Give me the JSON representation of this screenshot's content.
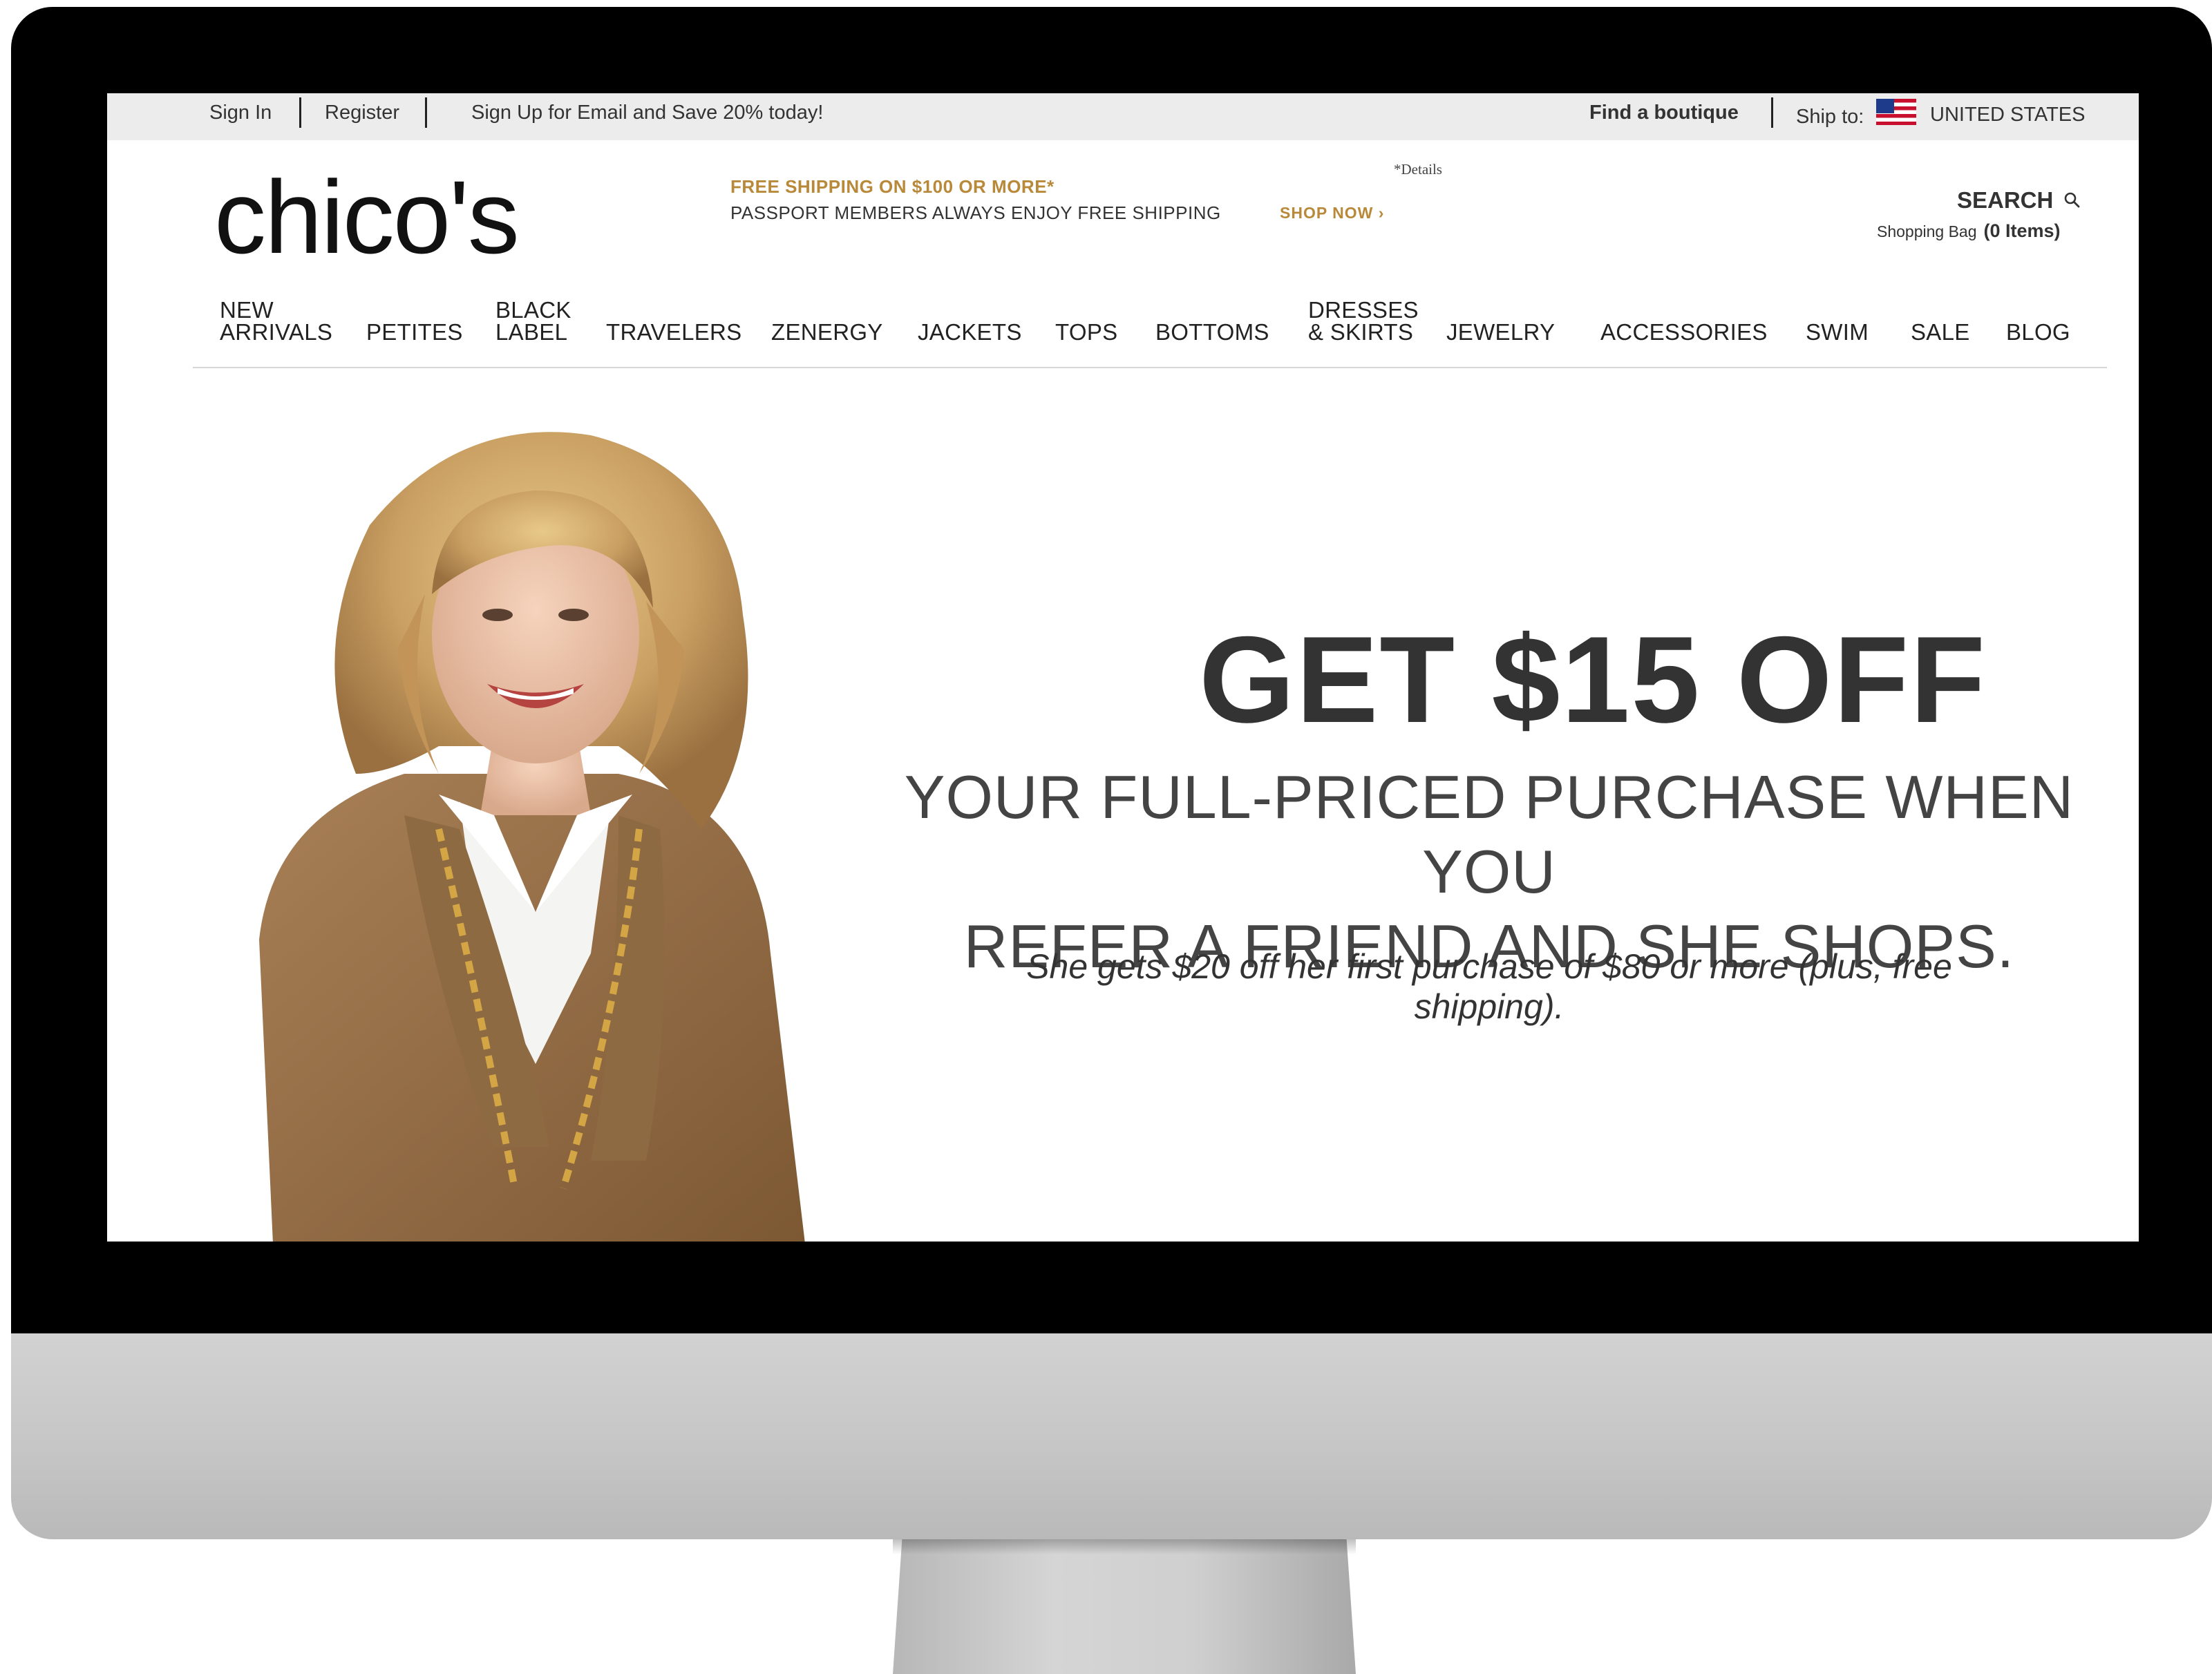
{
  "utility_bar": {
    "sign_in": "Sign In",
    "register": "Register",
    "email_promo": "Sign Up for Email and Save 20% today!",
    "find_boutique": "Find a boutique",
    "ship_to": "Ship to:",
    "country": "UNITED STATES"
  },
  "header": {
    "logo": "chico's",
    "shipping_promo": "FREE SHIPPING ON $100 OR MORE*",
    "passport_note": "PASSPORT MEMBERS ALWAYS ENJOY FREE SHIPPING",
    "shop_now": "SHOP NOW ›",
    "details": "*Details",
    "search": "SEARCH",
    "shopping_bag": "Shopping Bag",
    "bag_count": "(0 Items)"
  },
  "nav": {
    "items": [
      {
        "line1": "NEW",
        "line2": "ARRIVALS"
      },
      {
        "line1": "",
        "line2": "PETITES"
      },
      {
        "line1": "BLACK",
        "line2": "LABEL"
      },
      {
        "line1": "",
        "line2": "TRAVELERS"
      },
      {
        "line1": "",
        "line2": "ZENERGY"
      },
      {
        "line1": "",
        "line2": "JACKETS"
      },
      {
        "line1": "",
        "line2": "TOPS"
      },
      {
        "line1": "",
        "line2": "BOTTOMS"
      },
      {
        "line1": "DRESSES",
        "line2": "& SKIRTS"
      },
      {
        "line1": "",
        "line2": "JEWELRY"
      },
      {
        "line1": "",
        "line2": "ACCESSORIES"
      },
      {
        "line1": "",
        "line2": "SWIM"
      },
      {
        "line1": "",
        "line2": "SALE"
      },
      {
        "line1": "",
        "line2": "BLOG"
      }
    ]
  },
  "hero": {
    "title": "GET $15 OFF",
    "subtitle_line1": "YOUR FULL-PRICED PURCHASE WHEN YOU",
    "subtitle_line2": "REFER A FRIEND AND SHE SHOPS.",
    "note": "She gets $20 off her first purchase of $80 or more (plus, free shipping)."
  },
  "colors": {
    "accent_gold": "#b9893a",
    "text_dark": "#333333",
    "utility_bar_bg": "#ececec",
    "bezel": "#000000"
  }
}
